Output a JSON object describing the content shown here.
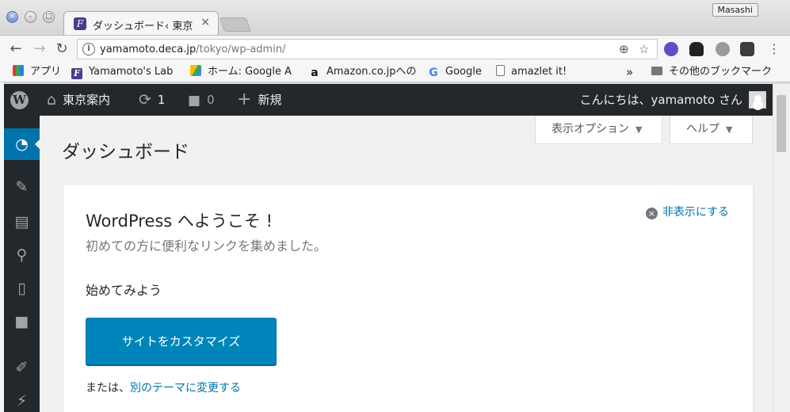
{
  "browser": {
    "tab_title": "ダッシュボード‹ 東京",
    "tab_close": "×",
    "profile_name": "Masashi",
    "url_host": "yamamoto.deca.jp",
    "url_path": "/tokyo/wp-admin/",
    "info_glyph": "i"
  },
  "bookmarks": {
    "apps": "アプリ",
    "items": [
      {
        "label": "Yamamoto's Lab",
        "icon": "purple-f-icon"
      },
      {
        "label": "ホーム: Google A",
        "icon": "google-drive-icon"
      },
      {
        "label": "Amazon.co.jpへの",
        "icon": "amazon-icon"
      },
      {
        "label": "Google",
        "icon": "google-icon"
      },
      {
        "label": "amazlet it!",
        "icon": "page-icon"
      }
    ],
    "overflow": "»",
    "other": "その他のブックマーク"
  },
  "adminbar": {
    "site_name": "東京案内",
    "updates_count": "1",
    "comments_count": "0",
    "new_label": "新規",
    "greeting": "こんにちは、yamamoto さん"
  },
  "screen_meta": {
    "options_label": "表示オプション",
    "help_label": "ヘルプ"
  },
  "page": {
    "title": "ダッシュボード"
  },
  "welcome": {
    "title": "WordPress へようこそ !",
    "subtitle": "初めての方に便利なリンクを集めました。",
    "dismiss": "非表示にする",
    "get_started": "始めてみよう",
    "customize_button": "サイトをカスタマイズ",
    "alt_prefix": "または、",
    "alt_link": "別のテーマに変更する"
  },
  "colors": {
    "admin_bar": "#23282d",
    "menu_current": "#0073aa",
    "primary_button": "#0085ba",
    "link": "#0073aa"
  }
}
